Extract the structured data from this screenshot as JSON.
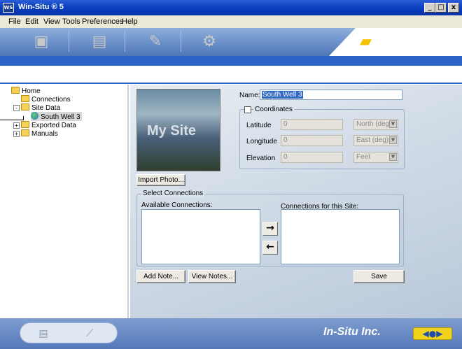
{
  "window": {
    "app_icon_text": "WS",
    "title": "Win-Situ ® 5",
    "minimize": "_",
    "maximize": "□",
    "close": "x"
  },
  "menu": [
    "File",
    "Edit",
    "View",
    "Tools",
    "Preferences",
    "Help"
  ],
  "toolbar": {
    "icons": [
      "site-data-icon",
      "logger-icon",
      "tools-icon",
      "settings-icon",
      "open-folder-icon"
    ]
  },
  "tree": {
    "items": [
      {
        "label": "Home",
        "icon": "folder-open-icon"
      },
      {
        "label": "Connections",
        "icon": "folder-open-icon"
      },
      {
        "label": "Site Data",
        "icon": "folder-open-icon",
        "expander": "-"
      },
      {
        "label": "South Well 3",
        "icon": "globe-icon",
        "selected": true
      },
      {
        "label": "Exported Data",
        "icon": "folder-open-icon",
        "expander": "+"
      },
      {
        "label": "Manuals",
        "icon": "folder-open-icon",
        "expander": "+"
      }
    ]
  },
  "site": {
    "photo_caption": "My Site",
    "import_photo_label": "Import Photo...",
    "name_label": "Name:",
    "name_value": "South Well 3",
    "coordinates_label": "Coordinates",
    "coordinates_checked": false,
    "latitude_label": "Latitude",
    "latitude_value": "0",
    "latitude_unit": "North (deg)",
    "longitude_label": "Longitude",
    "longitude_value": "0",
    "longitude_unit": "East (deg)",
    "elevation_label": "Elevation",
    "elevation_value": "0",
    "elevation_unit": "Feet"
  },
  "connections": {
    "group_label": "Select Connections",
    "available_label": "Available Connections:",
    "site_label": "Connections for this Site:",
    "add_arrow": "→",
    "remove_arrow": "←"
  },
  "buttons": {
    "add_note": "Add Note...",
    "view_notes": "View Notes...",
    "save": "Save"
  },
  "footer": {
    "brand": "In-Situ Inc.",
    "badge": "◀●▶",
    "icons": [
      "report-icon",
      "graph-icon"
    ]
  }
}
